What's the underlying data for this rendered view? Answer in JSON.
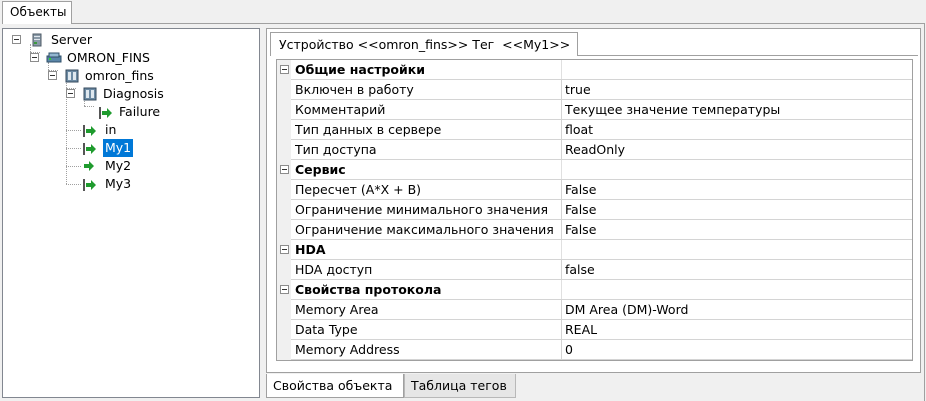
{
  "window": {
    "top_tab": "Объекты"
  },
  "tree": {
    "nodes": [
      {
        "label": "Server",
        "icon": "server-icon"
      },
      {
        "label": "OMRON_FINS",
        "icon": "network-icon"
      },
      {
        "label": "omron_fins",
        "icon": "device-icon"
      },
      {
        "label": "Diagnosis",
        "icon": "device-icon"
      },
      {
        "label": "Failure",
        "icon": "green-arrow-icon"
      },
      {
        "label": "in",
        "icon": "green-arrow-icon"
      },
      {
        "label": "My1",
        "icon": "green-arrow-icon",
        "selected": true
      },
      {
        "label": "My2",
        "icon": "green-arrow-icon"
      },
      {
        "label": "My3",
        "icon": "green-arrow-icon"
      }
    ]
  },
  "properties_tab": {
    "title": "Устройство <<omron_fins>> Тег  <<My1>>"
  },
  "groups": [
    {
      "name": "Общие настройки",
      "rows": [
        {
          "name": "Включен в работу",
          "value": "true"
        },
        {
          "name": "Комментарий",
          "value": "Текущее значение температуры"
        },
        {
          "name": "Тип данных в сервере",
          "value": "float"
        },
        {
          "name": "Тип доступа",
          "value": "ReadOnly"
        }
      ]
    },
    {
      "name": "Сервис",
      "rows": [
        {
          "name": "Пересчет (A*X + B)",
          "value": "False"
        },
        {
          "name": "Ограничение минимального значения",
          "value": "False"
        },
        {
          "name": "Ограничение максимального значения",
          "value": "False"
        }
      ]
    },
    {
      "name": "HDA",
      "rows": [
        {
          "name": "HDA доступ",
          "value": "false"
        }
      ]
    },
    {
      "name": "Свойства протокола",
      "rows": [
        {
          "name": "Memory Area",
          "value": "DM Area (DM)-Word"
        },
        {
          "name": "Data Type",
          "value": "REAL"
        },
        {
          "name": "Memory Address",
          "value": "0"
        }
      ]
    }
  ],
  "bottom_tabs": {
    "active": "Свойства объекта",
    "inactive": "Таблица тегов"
  },
  "colors": {
    "selection": "#0078d7",
    "arrow_green": "#1f9b2e"
  }
}
